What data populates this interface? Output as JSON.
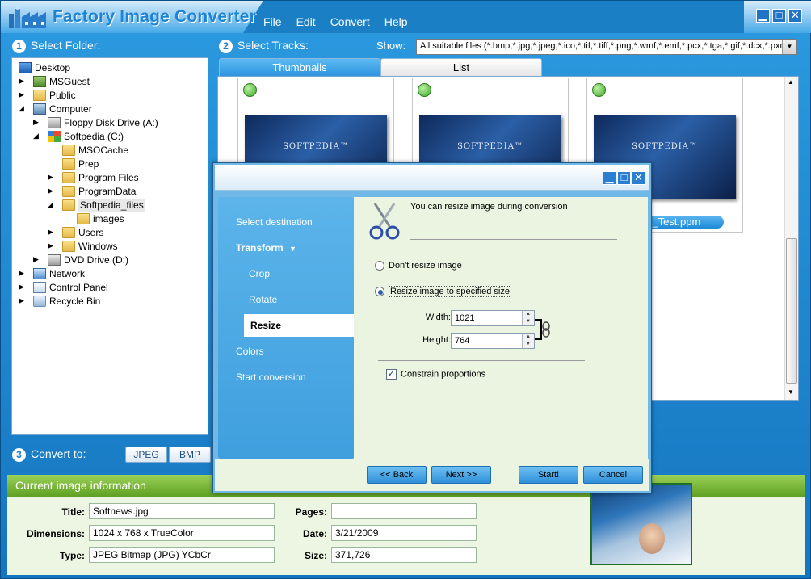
{
  "app": {
    "title": "Factory Image Converter",
    "menu": [
      "File",
      "Edit",
      "Convert",
      "Help"
    ],
    "window_buttons": {
      "minimize": "▁",
      "maximize": "□",
      "close": "✕"
    }
  },
  "step1": {
    "number": "1",
    "label": "Select Folder:"
  },
  "step2": {
    "number": "2",
    "label": "Select Tracks:",
    "show_label": "Show:",
    "show_value": "All suitable files (*.bmp,*.jpg,*.jpeg,*.ico,*.tif,*.tiff,*.png,*.wmf,*.emf,*.pcx,*.tga,*.gif,*.dcx,*.pxm,*."
  },
  "step3": {
    "number": "3",
    "label": "Convert to:",
    "formats": [
      "JPEG",
      "BMP"
    ]
  },
  "folder_tree": [
    {
      "label": "Desktop",
      "icon": "desktop-icon",
      "arrow": ""
    },
    {
      "label": "MSGuest",
      "icon": "user-folder-icon",
      "arrow": "▶"
    },
    {
      "label": "Public",
      "icon": "folder-icon",
      "arrow": "▶"
    },
    {
      "label": "Computer",
      "icon": "computer-icon",
      "arrow": "◢"
    },
    {
      "label": "Floppy Disk Drive (A:)",
      "icon": "floppy-drive-icon",
      "arrow": "▶"
    },
    {
      "label": "Softpedia (C:)",
      "icon": "windows-drive-icon",
      "arrow": "◢"
    },
    {
      "label": "MSOCache",
      "icon": "folder-icon",
      "arrow": ""
    },
    {
      "label": "Prep",
      "icon": "folder-icon",
      "arrow": ""
    },
    {
      "label": "Program Files",
      "icon": "folder-icon",
      "arrow": "▶"
    },
    {
      "label": "ProgramData",
      "icon": "folder-icon",
      "arrow": "▶"
    },
    {
      "label": "Softpedia_files",
      "icon": "folder-icon",
      "arrow": "◢"
    },
    {
      "label": "images",
      "icon": "folder-icon",
      "arrow": ""
    },
    {
      "label": "Users",
      "icon": "folder-icon",
      "arrow": "▶"
    },
    {
      "label": "Windows",
      "icon": "folder-icon",
      "arrow": "▶"
    },
    {
      "label": "DVD Drive (D:)",
      "icon": "dvd-drive-icon",
      "arrow": "▶"
    },
    {
      "label": "Network",
      "icon": "network-icon",
      "arrow": "▶"
    },
    {
      "label": "Control Panel",
      "icon": "control-panel-icon",
      "arrow": "▶"
    },
    {
      "label": "Recycle Bin",
      "icon": "recycle-bin-icon",
      "arrow": "▶"
    }
  ],
  "tabs": {
    "thumbnails": "Thumbnails",
    "list": "List"
  },
  "thumbnails": [
    {
      "brand": "SOFTPEDIA™"
    },
    {
      "brand": "SOFTPEDIA™"
    },
    {
      "brand": "SOFTPEDIA™"
    }
  ],
  "selected_filename_fragment": "dia_Test.ppm",
  "current_image": {
    "header": "Current image information",
    "title_label": "Title:",
    "title_value": "Softnews.jpg",
    "dimensions_label": "Dimensions:",
    "dimensions_value": "1024 x 768 x TrueColor",
    "type_label": "Type:",
    "type_value": "JPEG Bitmap (JPG) YCbCr",
    "pages_label": "Pages:",
    "pages_value": "",
    "date_label": "Date:",
    "date_value": "3/21/2009",
    "size_label": "Size:",
    "size_value": "371,726"
  },
  "dialog": {
    "nav": {
      "select_destination": "Select destination",
      "transform": "Transform",
      "crop": "Crop",
      "rotate": "Rotate",
      "resize": "Resize",
      "colors": "Colors",
      "start_conversion": "Start conversion"
    },
    "heading": "You can resize image during conversion",
    "option_no_resize": "Don't resize image",
    "option_resize": "Resize image to specified size",
    "selected_option": "resize",
    "width_label": "Width:",
    "width_value": "1021",
    "height_label": "Height:",
    "height_value": "764",
    "constrain_label": "Constrain proportions",
    "constrain_checked": true,
    "buttons": {
      "back": "<< Back",
      "next": "Next >>",
      "start": "Start!",
      "cancel": "Cancel"
    }
  }
}
